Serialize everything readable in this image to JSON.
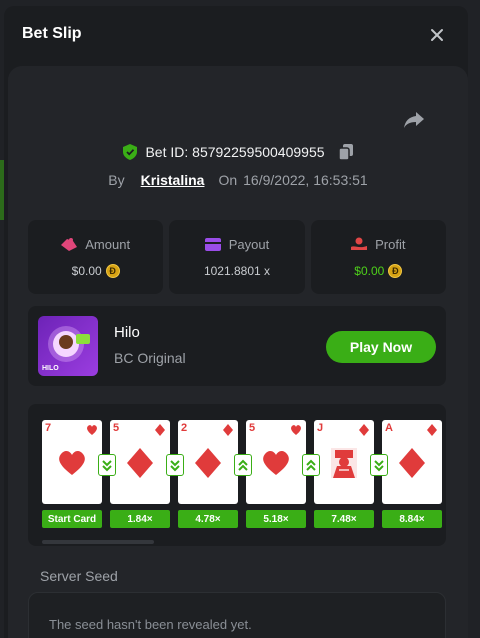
{
  "modal": {
    "title": "Bet Slip"
  },
  "bet": {
    "id_label": "Bet ID: 85792259500409955",
    "by_label": "By",
    "username": "Kristalina",
    "on_label": "On",
    "datetime": "16/9/2022, 16:53:51"
  },
  "stats": [
    {
      "label": "Amount",
      "value": "$0.00",
      "value_color": "#c9ccd0",
      "icon": "amount-icon",
      "icon_color": "#e0467a"
    },
    {
      "label": "Payout",
      "value": "1021.8801 x",
      "value_color": "#c9ccd0",
      "icon": "wallet-icon",
      "icon_color": "#9a4de8"
    },
    {
      "label": "Profit",
      "value": "$0.00",
      "value_color": "#4ed01a",
      "icon": "profit-icon",
      "icon_color": "#e04646"
    }
  ],
  "game": {
    "name": "Hilo",
    "provider": "BC Original",
    "play_label": "Play Now",
    "thumb_text": "HILO"
  },
  "cards": [
    {
      "rank": "7",
      "suit": "heart",
      "multiplier": "Start Card",
      "arrow": null
    },
    {
      "rank": "5",
      "suit": "diamond",
      "multiplier": "1.84×",
      "arrow": "down"
    },
    {
      "rank": "2",
      "suit": "diamond",
      "multiplier": "4.78×",
      "arrow": "down"
    },
    {
      "rank": "5",
      "suit": "heart",
      "multiplier": "5.18×",
      "arrow": "up"
    },
    {
      "rank": "J",
      "suit": "jack-face",
      "multiplier": "7.48×",
      "arrow": "up"
    },
    {
      "rank": "A",
      "suit": "diamond",
      "multiplier": "8.84×",
      "arrow": "down"
    }
  ],
  "seed": {
    "label": "Server Seed",
    "text": "The seed hasn't been revealed yet."
  },
  "colors": {
    "accent": "#3aae16",
    "suit_red": "#e03b3b"
  }
}
